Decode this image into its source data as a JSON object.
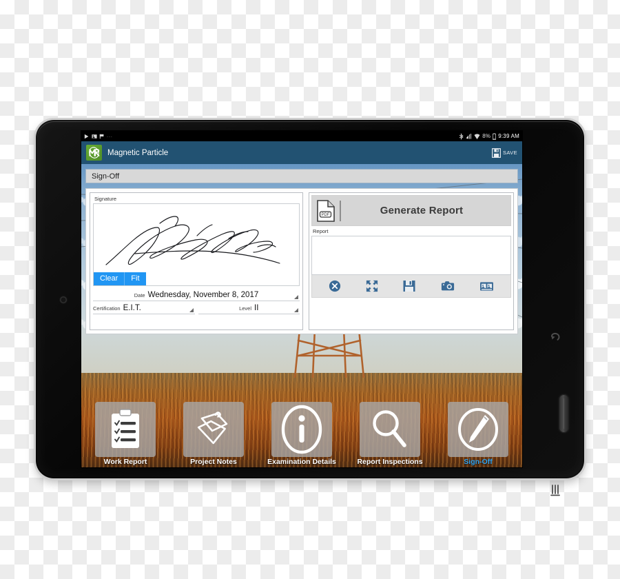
{
  "device": {
    "type": "tablet",
    "frame_color": "#0a0a0a",
    "softkeys": [
      {
        "name": "back",
        "icon": "back-arrow-icon"
      },
      {
        "name": "home",
        "icon": "home-button"
      },
      {
        "name": "recents",
        "icon": "recent-apps-icon"
      }
    ]
  },
  "statusbar": {
    "notification_icons": [
      "play-notification-icon",
      "image-notification-icon",
      "flag-notification-icon"
    ],
    "overflow": "...",
    "right_icons": [
      "bluetooth-icon",
      "signal-icon",
      "wifi-icon"
    ],
    "battery_percent": "8%",
    "battery_icon": "battery-icon",
    "clock": "9:39 AM"
  },
  "appbar": {
    "logo_text": "MR",
    "logo_color": "#5c9e2e",
    "title": "Magnetic Particle",
    "bar_color": "#225272",
    "save_label": "SAVE",
    "save_icon": "floppy-disk-icon"
  },
  "section": {
    "title": "Sign-Off"
  },
  "signature_panel": {
    "label": "Signature",
    "buttons": [
      {
        "label": "Clear",
        "color": "#2196f3"
      },
      {
        "label": "Fit",
        "color": "#2196f3"
      }
    ],
    "fields": [
      {
        "label": "Date",
        "value": "Wednesday, November 8, 2017"
      },
      {
        "label": "Certification",
        "value": "E.I.T."
      },
      {
        "label": "Level",
        "value": "II"
      }
    ]
  },
  "report_panel": {
    "generate_button_label": "Generate Report",
    "generate_button_icon": "pdf-file-icon",
    "report_label": "Report",
    "report_value": "",
    "toolbar_icons": [
      "close-circle-icon",
      "expand-fullscreen-icon",
      "floppy-save-icon",
      "camera-icon",
      "gallery-icon"
    ],
    "toolbar_color": "#3a6a96"
  },
  "bottom_nav": {
    "active": "Sign-Off",
    "active_color": "#2fa3f0",
    "items": [
      {
        "label": "Work Report",
        "icon": "clipboard-checklist-icon"
      },
      {
        "label": "Project Notes",
        "icon": "sticky-notes-icon"
      },
      {
        "label": "Examination Details",
        "icon": "info-circle-icon"
      },
      {
        "label": "Report Inspections",
        "icon": "magnifier-icon"
      },
      {
        "label": "Sign-Off",
        "icon": "pen-circle-icon"
      }
    ]
  },
  "background": {
    "description": "transmission tower under cloudy sky over dry orange field",
    "sky_color": "#90b3d2",
    "ground_color": "#a4541a",
    "tower_color": "#b0622c"
  }
}
